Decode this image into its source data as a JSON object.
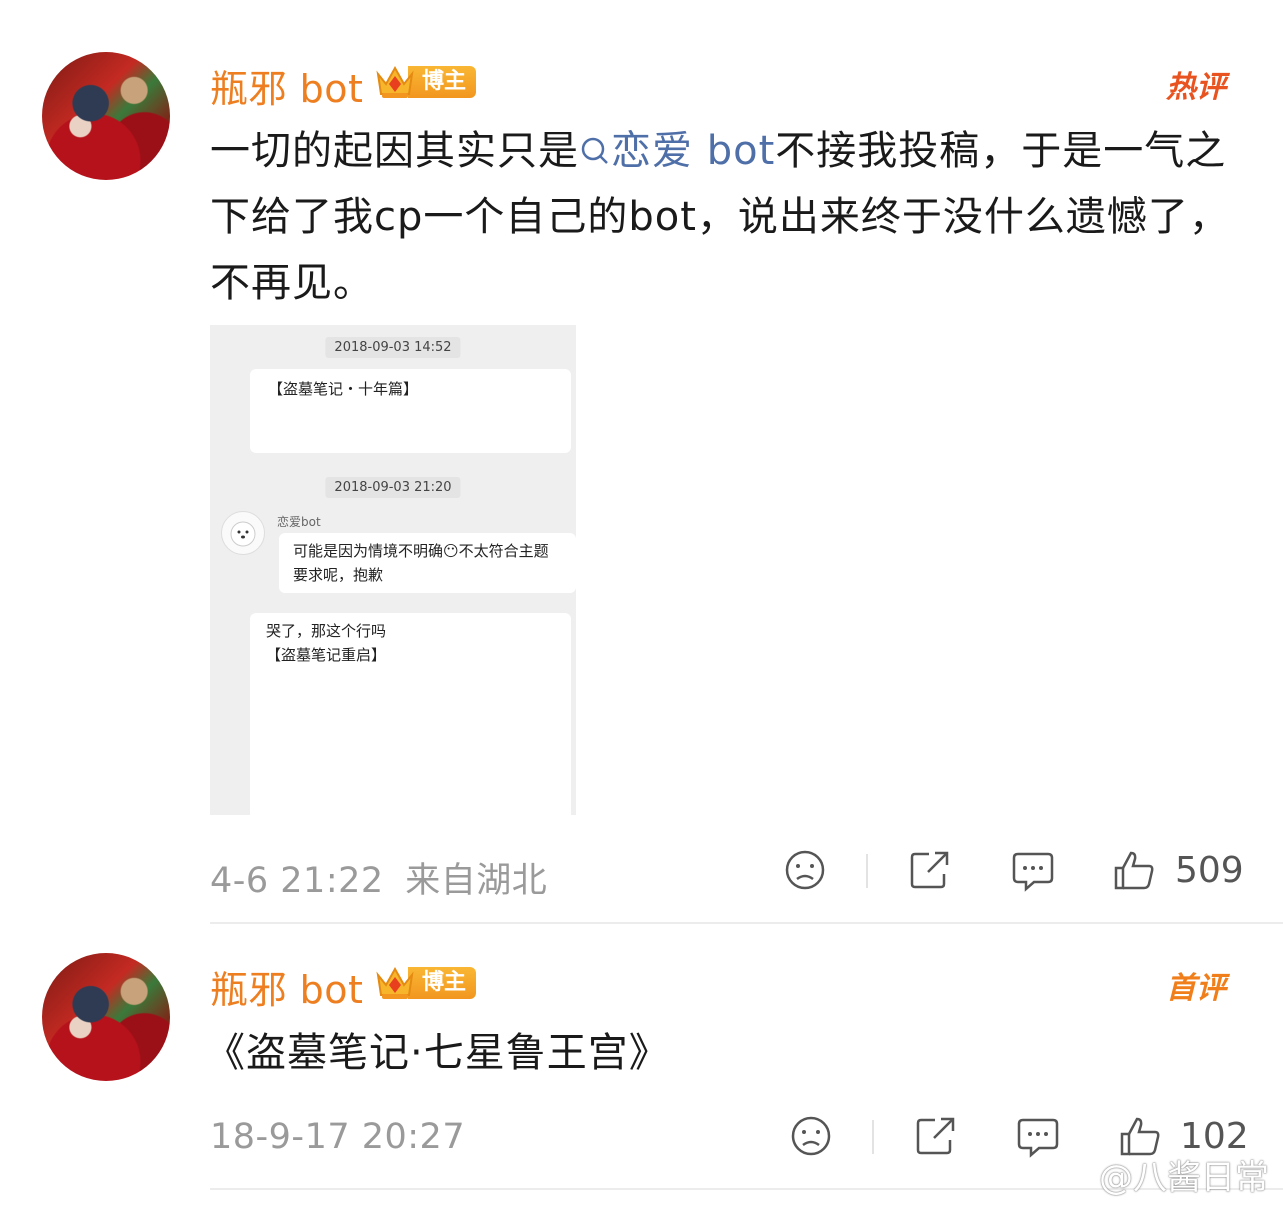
{
  "comments": [
    {
      "username": "瓶邪 bot",
      "badge": "博主",
      "tag": "热评",
      "text_before_link": "一切的起因其实只是",
      "link_text": "恋爱 bot",
      "text_after_link": "不接我投稿，于是一气之下给了我cp一个自己的bot，说出来终于没什么遗憾了，不再见。",
      "time": "4-6 21:22",
      "location": "来自湖北",
      "likes": "509"
    },
    {
      "username": "瓶邪 bot",
      "badge": "博主",
      "tag": "首评",
      "text": "《盗墓笔记·七星鲁王宫》",
      "time": "18-9-17 20:27",
      "likes": "102"
    }
  ],
  "screenshot": {
    "timestamp1": "2018-09-03 14:52",
    "bubble1": "【盗墓笔记・十年篇】",
    "timestamp2": "2018-09-03 21:20",
    "sender": "恋爱bot",
    "reply": "可能是因为情境不明确😶不太符合主题要求呢，抱歉",
    "message_line1": "哭了，那这个行吗",
    "message_line2": "【盗墓笔记重启】"
  },
  "watermark": "@八酱日常",
  "colors": {
    "username": "#ee7f21",
    "link": "#4f6fa8",
    "hot_tag": "#e8531f",
    "meta": "#9a9a9a"
  }
}
